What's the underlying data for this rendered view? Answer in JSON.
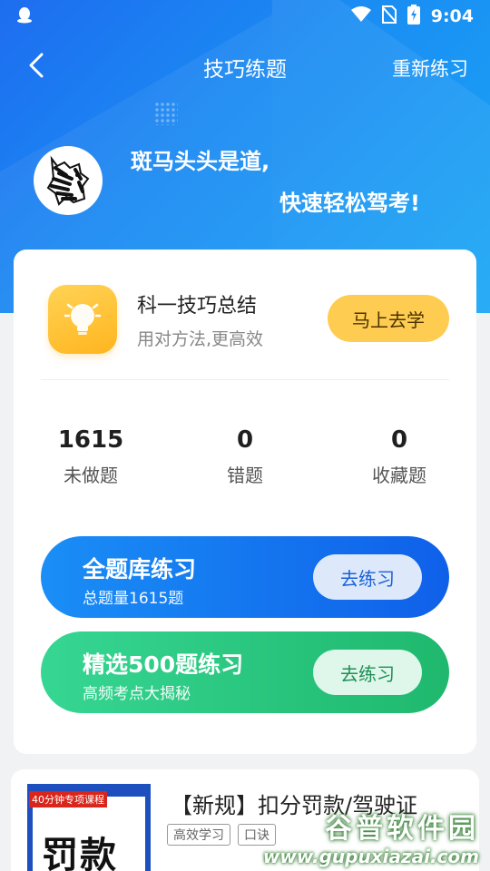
{
  "status_bar": {
    "time": "9:04"
  },
  "nav": {
    "title": "技巧练题",
    "action_label": "重新练习"
  },
  "hero": {
    "slogan_line1": "斑马头头是道,",
    "slogan_line2": "快速轻松驾考!"
  },
  "summary": {
    "title": "科一技巧总结",
    "subtitle": "用对方法,更高效",
    "button_label": "马上去学"
  },
  "stats": [
    {
      "value": "1615",
      "label": "未做题"
    },
    {
      "value": "0",
      "label": "错题"
    },
    {
      "value": "0",
      "label": "收藏题"
    }
  ],
  "practices": [
    {
      "title": "全题库练习",
      "subtitle": "总题量1615题",
      "button_label": "去练习",
      "color": "#1a7af0"
    },
    {
      "title": "精选500题练习",
      "subtitle": "高频考点大揭秘",
      "button_label": "去练习",
      "color": "#2bc77f"
    }
  ],
  "course": {
    "badge": "40分钟专项课程",
    "thumb_text": "罚款",
    "title": "【新规】扣分罚款/驾驶证",
    "chips": [
      "高效学习",
      "口诀"
    ]
  },
  "watermark": {
    "line1": "谷普软件园",
    "line2": "www.gupuxiazai.com"
  },
  "colors": {
    "accent_blue": "#1a7af0",
    "accent_green": "#2bc77f",
    "accent_yellow": "#ffcc52"
  }
}
